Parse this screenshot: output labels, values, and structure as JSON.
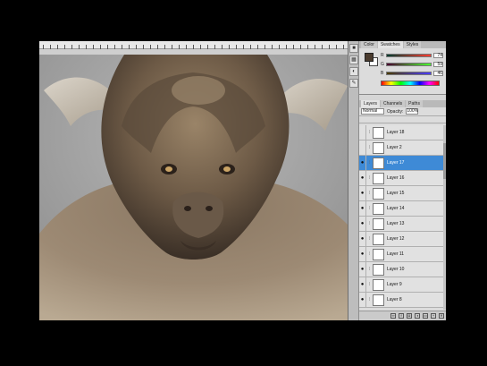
{
  "color_panel": {
    "tabs": [
      "Color",
      "Swatches",
      "Styles"
    ],
    "fg_color": "#4a3b2e",
    "bg_color": "#ffffff",
    "channels": [
      {
        "name": "R",
        "value": "74"
      },
      {
        "name": "G",
        "value": "59"
      },
      {
        "name": "B",
        "value": "46"
      }
    ]
  },
  "layers_panel": {
    "tabs": [
      "Layers",
      "Channels",
      "Paths"
    ],
    "blend_mode": "Normal",
    "opacity_label": "Opacity:",
    "opacity_value": "100%",
    "layers": [
      {
        "name": "Layer 18",
        "selected": false,
        "visible": false
      },
      {
        "name": "Layer 2",
        "selected": false,
        "visible": false
      },
      {
        "name": "Layer 17",
        "selected": true,
        "visible": true
      },
      {
        "name": "Layer 16",
        "selected": false,
        "visible": true
      },
      {
        "name": "Layer 15",
        "selected": false,
        "visible": true
      },
      {
        "name": "Layer 14",
        "selected": false,
        "visible": true
      },
      {
        "name": "Layer 13",
        "selected": false,
        "visible": true
      },
      {
        "name": "Layer 12",
        "selected": false,
        "visible": true
      },
      {
        "name": "Layer 11",
        "selected": false,
        "visible": true
      },
      {
        "name": "Layer 10",
        "selected": false,
        "visible": true
      },
      {
        "name": "Layer 9",
        "selected": false,
        "visible": true
      },
      {
        "name": "Layer 8",
        "selected": false,
        "visible": true
      }
    ]
  },
  "icons": {
    "eye": "eye-icon",
    "chain": "link-icon"
  },
  "accent_color": "#3e8ad6"
}
